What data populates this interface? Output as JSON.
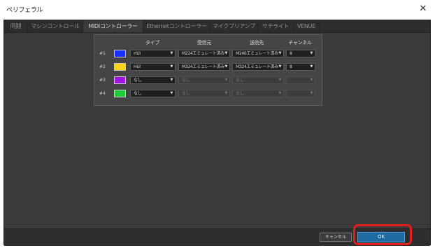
{
  "window": {
    "title": "ペリフェラル",
    "close_icon": "close-icon"
  },
  "tabs": [
    {
      "label": "同期",
      "active": false
    },
    {
      "label": "マシンコントロール",
      "active": false
    },
    {
      "label": "MIDIコントローラー",
      "active": true
    },
    {
      "label": "Ethernetコントローラー",
      "active": false
    },
    {
      "label": "マイクプリアンプ",
      "active": false
    },
    {
      "label": "サテライト",
      "active": false
    },
    {
      "label": "VENUE",
      "active": false
    }
  ],
  "table": {
    "headers": {
      "type": "タイプ",
      "receive": "受信元",
      "send": "送信先",
      "channels": "チャンネル"
    },
    "rows": [
      {
        "num": "#1",
        "color": "#1730ff",
        "type": "HUI",
        "receive": "M224エミュレート済み",
        "send": "M240エミュレート済み",
        "channels": "8",
        "enabled": true
      },
      {
        "num": "#2",
        "color": "#ffd21a",
        "type": "HUI",
        "receive": "M324エミュレート済み",
        "send": "M324エミュレート済み",
        "channels": "8",
        "enabled": true
      },
      {
        "num": "#3",
        "color": "#9d17e0",
        "type": "なし",
        "receive": "なし",
        "send": "なし",
        "channels": "",
        "enabled": false
      },
      {
        "num": "#4",
        "color": "#22cc3d",
        "type": "なし",
        "receive": "なし",
        "send": "なし",
        "channels": "",
        "enabled": false
      }
    ]
  },
  "footer": {
    "cancel_label": "キャンセル",
    "ok_label": "OK"
  },
  "colors": {
    "highlight": "#e11d1d",
    "ok_button": "#1e6aa3"
  }
}
